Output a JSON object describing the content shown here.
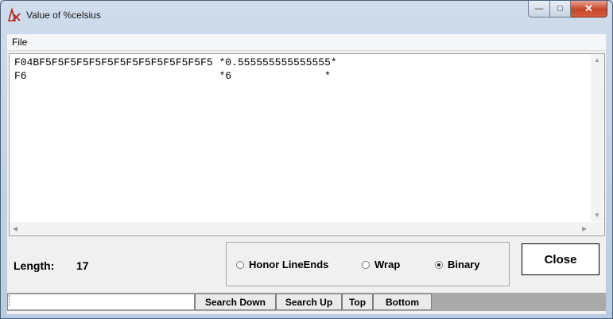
{
  "window": {
    "title": "Value of %celsius",
    "controls": {
      "minimize": "—",
      "maximize": "□",
      "close": "✕"
    }
  },
  "menu": {
    "file": "File"
  },
  "content": {
    "lines": [
      "F04BF5F5F5F5F5F5F5F5F5F5F5F5F5F5 *0.555555555555555*",
      "F6                               *6               *"
    ]
  },
  "length": {
    "label": "Length:",
    "value": "17"
  },
  "options": [
    {
      "label": "Honor LineEnds",
      "selected": false
    },
    {
      "label": "Wrap",
      "selected": false
    },
    {
      "label": "Binary",
      "selected": true
    }
  ],
  "close_label": "Close",
  "search": {
    "value": "",
    "buttons": [
      "Search Down",
      "Search Up",
      "Top",
      "Bottom"
    ]
  }
}
